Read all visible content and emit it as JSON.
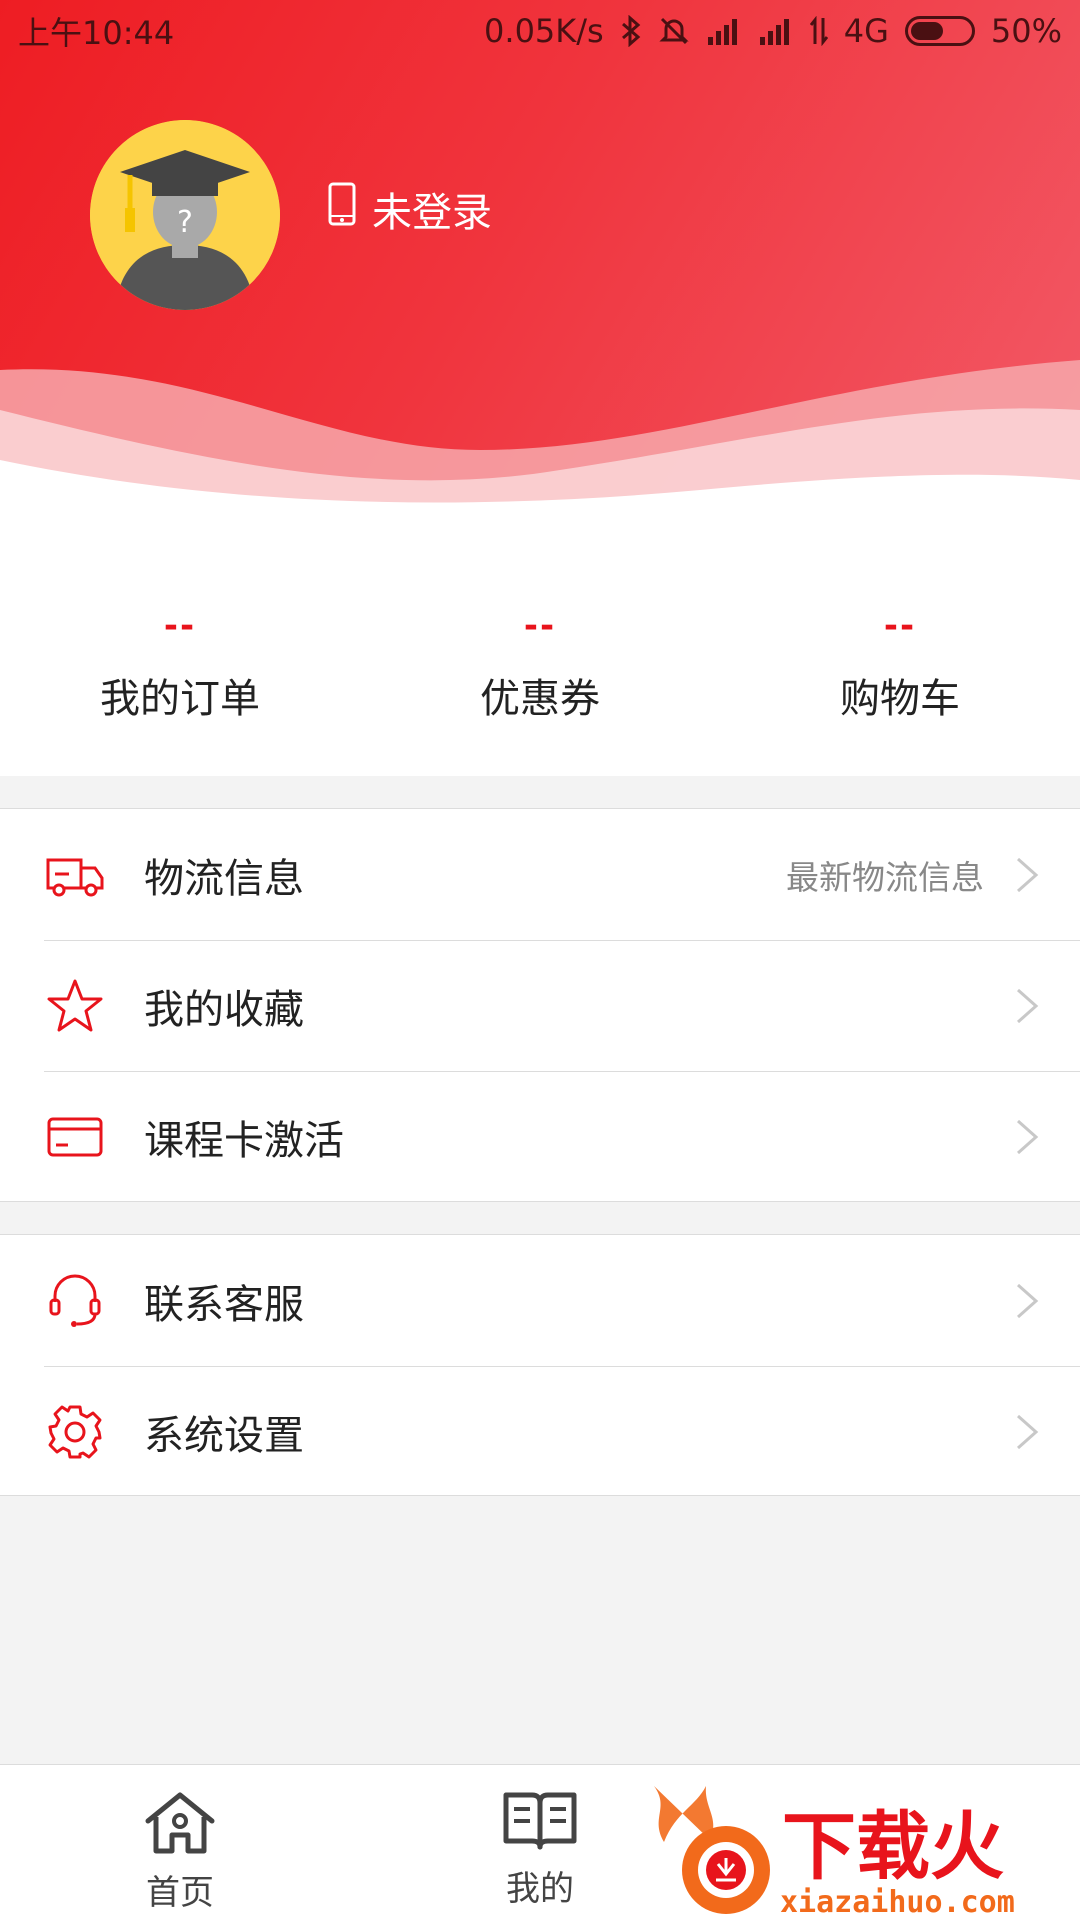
{
  "status_bar": {
    "time": "上午10:44",
    "speed": "0.05K/s",
    "network": "4G",
    "battery": "50%"
  },
  "profile": {
    "login_text": "未登录"
  },
  "stats": [
    {
      "value": "--",
      "label": "我的订单"
    },
    {
      "value": "--",
      "label": "优惠券"
    },
    {
      "value": "--",
      "label": "购物车"
    }
  ],
  "menu_group1": [
    {
      "label": "物流信息",
      "hint": "最新物流信息",
      "icon": "truck-icon"
    },
    {
      "label": "我的收藏",
      "hint": "",
      "icon": "star-icon"
    },
    {
      "label": "课程卡激活",
      "hint": "",
      "icon": "card-icon"
    }
  ],
  "menu_group2": [
    {
      "label": "联系客服",
      "icon": "headset-icon"
    },
    {
      "label": "系统设置",
      "icon": "gear-icon"
    }
  ],
  "bottom_nav": {
    "home": "首页",
    "mine": "我的"
  },
  "watermark": {
    "brand": "下载火",
    "url": "xiazaihuo.com"
  },
  "colors": {
    "accent": "#e8141c",
    "header_start": "#ee1d23",
    "header_end": "#f25a67",
    "avatar_bg": "#fdd34a"
  }
}
